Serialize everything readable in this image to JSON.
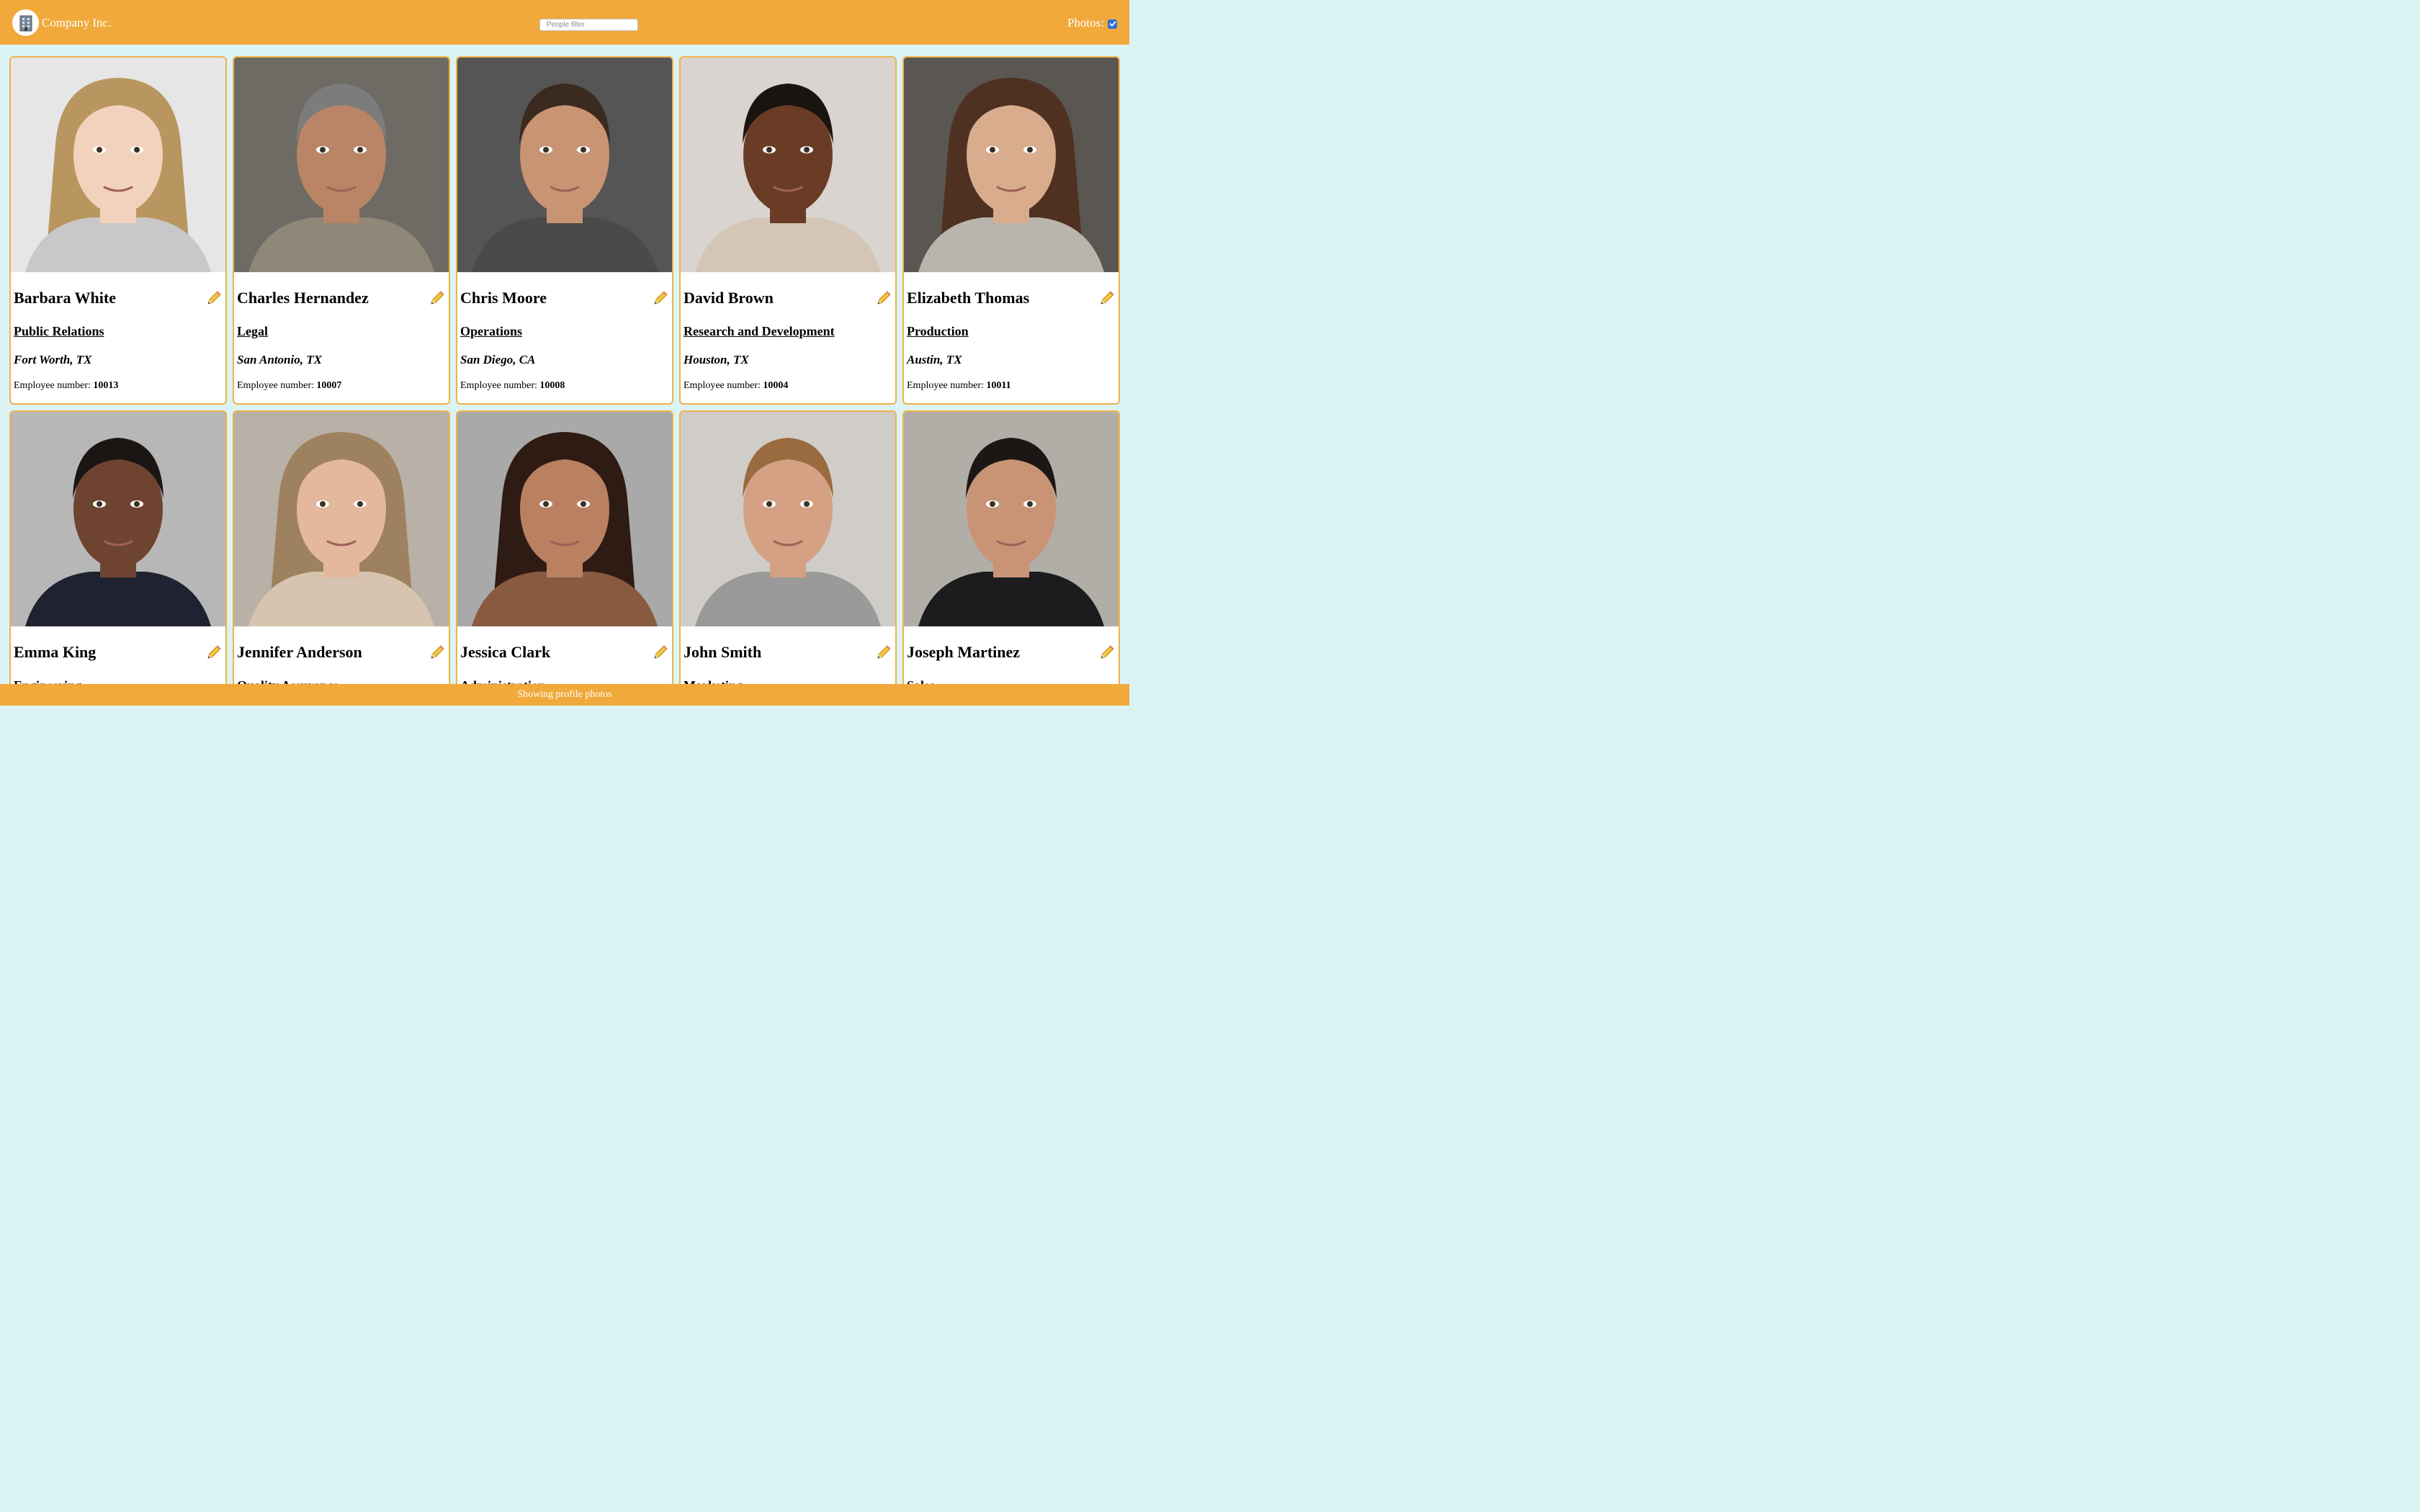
{
  "header": {
    "company_name": "Company Inc.",
    "logo_icon": "office-building-icon",
    "filter_placeholder": "People filter",
    "filter_value": "",
    "photos_label": "Photos:",
    "photos_checked": true
  },
  "colors": {
    "header_bg": "#f0a93a",
    "page_bg": "#dcf3f4",
    "card_border": "#f0b24a",
    "checkbox": "#2f6fd6"
  },
  "employees": [
    {
      "name": "Barbara White",
      "department": "Public Relations",
      "location": "Fort Worth, TX",
      "employee_label": "Employee number:",
      "employee_number": "10013",
      "edit_icon": "pencil-icon"
    },
    {
      "name": "Charles Hernandez",
      "department": "Legal",
      "location": "San Antonio, TX",
      "employee_label": "Employee number:",
      "employee_number": "10007",
      "edit_icon": "pencil-icon"
    },
    {
      "name": "Chris Moore",
      "department": "Operations",
      "location": "San Diego, CA",
      "employee_label": "Employee number:",
      "employee_number": "10008",
      "edit_icon": "pencil-icon"
    },
    {
      "name": "David Brown",
      "department": "Research and Development",
      "location": "Houston, TX",
      "employee_label": "Employee number:",
      "employee_number": "10004",
      "edit_icon": "pencil-icon"
    },
    {
      "name": "Elizabeth Thomas",
      "department": "Production",
      "location": "Austin, TX",
      "employee_label": "Employee number:",
      "employee_number": "10011",
      "edit_icon": "pencil-icon"
    },
    {
      "name": "Emma King",
      "department": "Engineering",
      "location": "",
      "employee_label": "",
      "employee_number": "",
      "edit_icon": "pencil-icon"
    },
    {
      "name": "Jennifer Anderson",
      "department": "Quality Assurance",
      "location": "",
      "employee_label": "",
      "employee_number": "",
      "edit_icon": "pencil-icon"
    },
    {
      "name": "Jessica Clark",
      "department": "Administration",
      "location": "",
      "employee_label": "",
      "employee_number": "",
      "edit_icon": "pencil-icon"
    },
    {
      "name": "John Smith",
      "department": "Marketing",
      "location": "",
      "employee_label": "",
      "employee_number": "",
      "edit_icon": "pencil-icon"
    },
    {
      "name": "Joseph Martinez",
      "department": "Sales",
      "location": "",
      "employee_label": "",
      "employee_number": "",
      "edit_icon": "pencil-icon"
    }
  ],
  "footer": {
    "status": "Showing profile photos"
  }
}
